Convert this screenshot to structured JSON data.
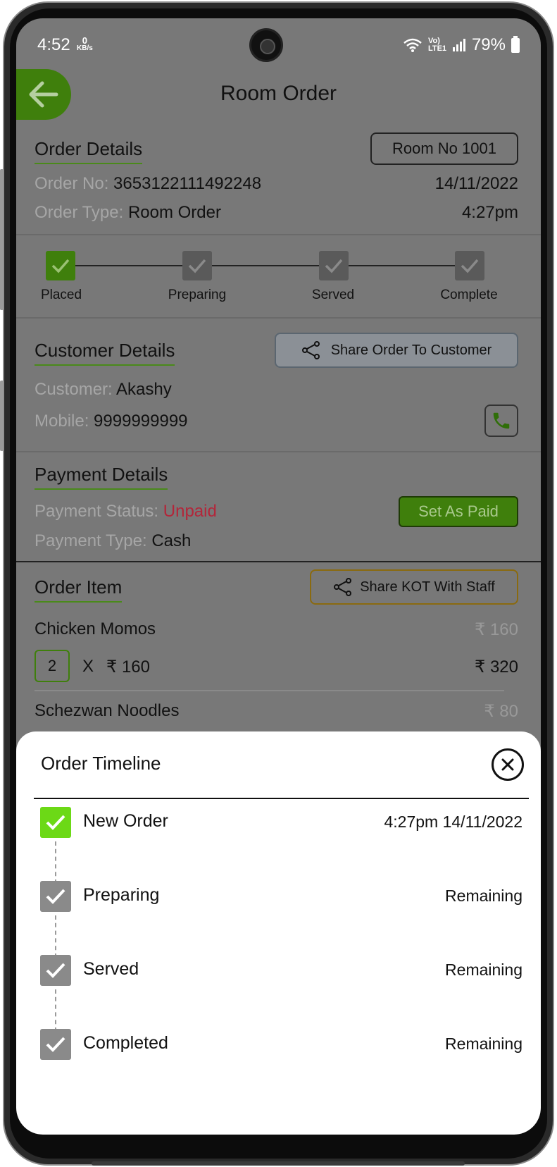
{
  "status_bar": {
    "time": "4:52",
    "kbs_value": "0",
    "kbs_unit": "KB/s",
    "network": "Vo) LTE1",
    "battery": "79%"
  },
  "header": {
    "title": "Room Order"
  },
  "order_details": {
    "title": "Order Details",
    "room": "Room No 1001",
    "order_no_label": "Order No:",
    "order_no": "3653122111492248",
    "date": "14/11/2022",
    "order_type_label": "Order Type:",
    "order_type": "Room Order",
    "time": "4:27pm"
  },
  "progress": {
    "steps": [
      "Placed",
      "Preparing",
      "Served",
      "Complete"
    ],
    "completed_count": 1
  },
  "customer_details": {
    "title": "Customer Details",
    "share_label": "Share Order To Customer",
    "customer_label": "Customer:",
    "customer": "Akashy",
    "mobile_label": "Mobile:",
    "mobile": "9999999999"
  },
  "payment_details": {
    "title": "Payment Details",
    "status_label": "Payment Status:",
    "status": "Unpaid",
    "type_label": "Payment Type:",
    "type": "Cash",
    "set_paid_label": "Set As Paid"
  },
  "order_items": {
    "title": "Order Item",
    "share_kot_label": "Share KOT With Staff",
    "items": [
      {
        "name": "Chicken Momos",
        "unit_price": "₹ 160",
        "qty": "2",
        "x": "X",
        "line_price": "₹ 160",
        "total": "₹ 320"
      },
      {
        "name": "Schezwan Noodles",
        "unit_price": "₹ 80"
      }
    ]
  },
  "timeline": {
    "title": "Order Timeline",
    "entries": [
      {
        "label": "New Order",
        "status": "4:27pm 14/11/2022",
        "done": true
      },
      {
        "label": "Preparing",
        "status": "Remaining",
        "done": false
      },
      {
        "label": "Served",
        "status": "Remaining",
        "done": false
      },
      {
        "label": "Completed",
        "status": "Remaining",
        "done": false
      }
    ]
  },
  "colors": {
    "accent_green": "#3f7f0c",
    "timeline_done": "#6cd916",
    "unpaid_red": "#b3263a",
    "overlay_gray": "#787878"
  }
}
